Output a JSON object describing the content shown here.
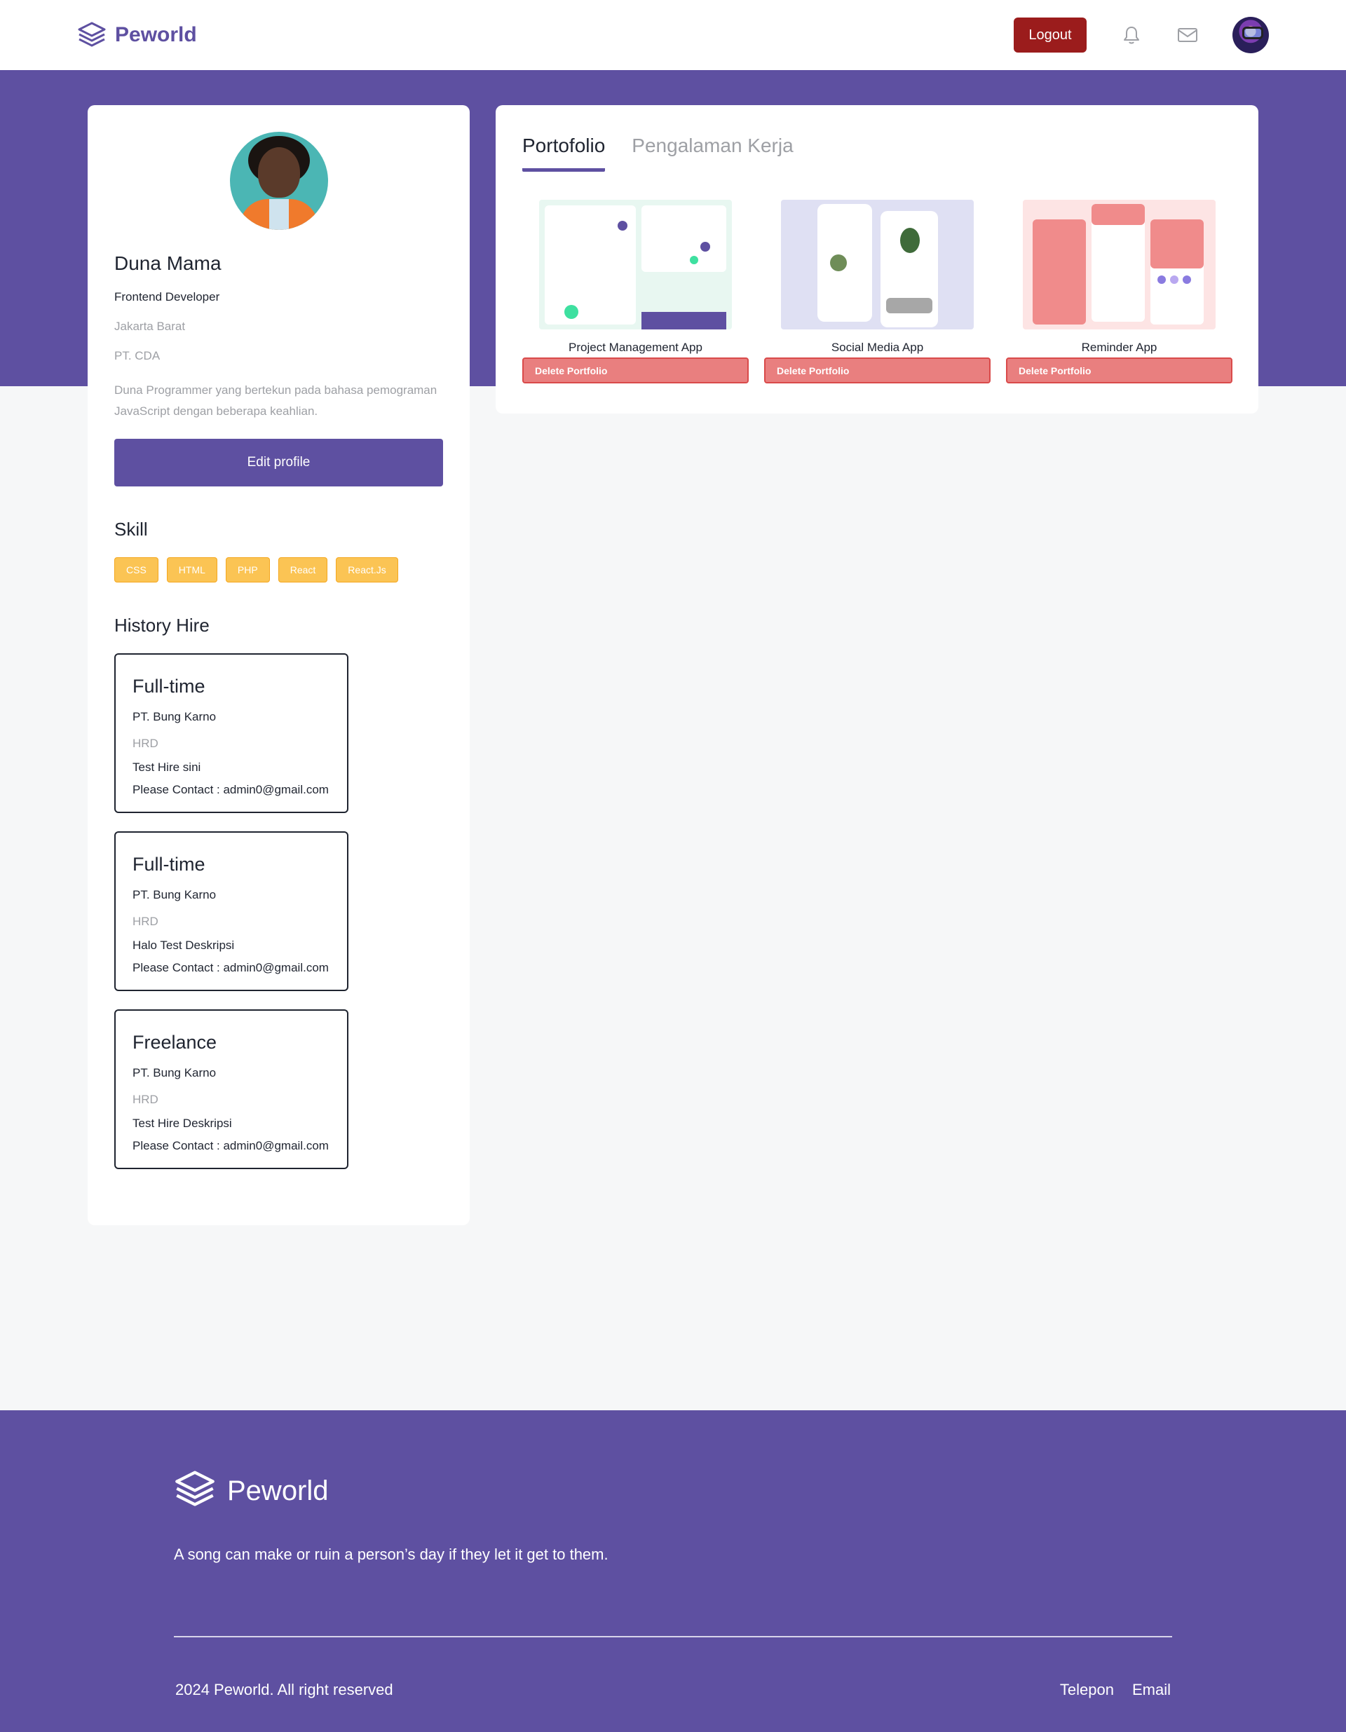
{
  "navbar": {
    "brand": "Peworld",
    "logout_label": "Logout",
    "icons": [
      "bell-icon",
      "mail-icon"
    ]
  },
  "profile": {
    "name": "Duna Mama",
    "job": "Frontend Developer",
    "location": "Jakarta Barat",
    "company": "PT. CDA",
    "description": "Duna Programmer yang bertekun pada bahasa pemograman JavaScript dengan beberapa keahlian.",
    "edit_label": "Edit profile",
    "skill_title": "Skill",
    "skills": [
      "CSS",
      "HTML",
      "PHP",
      "React",
      "React.Js"
    ],
    "history_title": "History Hire",
    "history": [
      {
        "type": "Full-time",
        "company": "PT. Bung Karno",
        "position": "HRD",
        "description": "Test Hire sini",
        "contact": "Please Contact : admin0@gmail.com"
      },
      {
        "type": "Full-time",
        "company": "PT. Bung Karno",
        "position": "HRD",
        "description": "Halo Test Deskripsi",
        "contact": "Please Contact : admin0@gmail.com"
      },
      {
        "type": "Freelance",
        "company": "PT. Bung Karno",
        "position": "HRD",
        "description": "Test Hire Deskripsi",
        "contact": "Please Contact : admin0@gmail.com"
      }
    ]
  },
  "tabs": [
    {
      "label": "Portofolio",
      "active": true
    },
    {
      "label": "Pengalaman Kerja",
      "active": false
    }
  ],
  "portfolio": [
    {
      "title": "Project Management App",
      "delete_label": "Delete Portfolio"
    },
    {
      "title": "Social Media App",
      "delete_label": "Delete Portfolio"
    },
    {
      "title": "Reminder App",
      "delete_label": "Delete Portfolio"
    }
  ],
  "footer": {
    "brand": "Peworld",
    "tagline": "A song can make or ruin a person’s day if they let it get to them.",
    "copyright": "2024 Peworld. All right reserved",
    "links": [
      "Telepon",
      "Email"
    ]
  },
  "colors": {
    "primary": "#5e50a1",
    "logout": "#9b1c1c",
    "skill": "#fbc454",
    "delete": "#e97f7f"
  }
}
